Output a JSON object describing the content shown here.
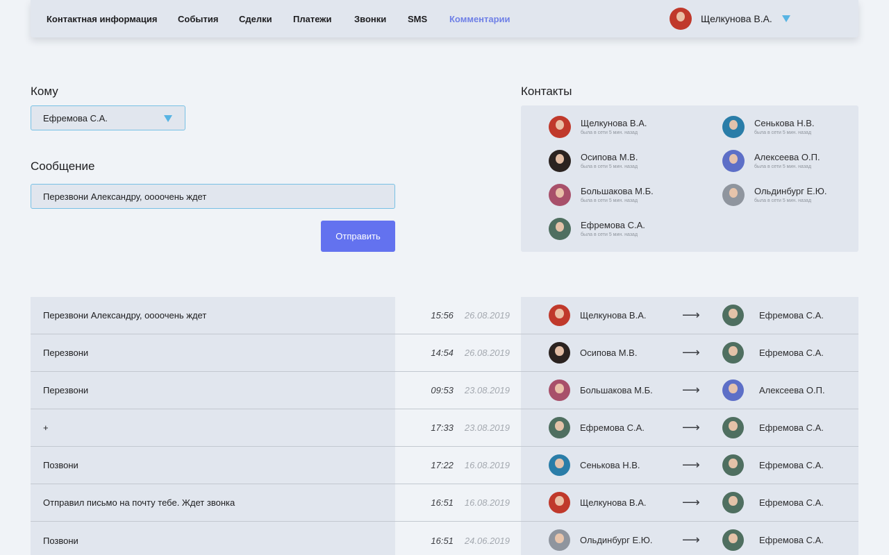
{
  "nav": {
    "items": [
      "Контактная информация",
      "События",
      "Сделки",
      "Платежи",
      "Звонки",
      "SMS",
      "Комментарии"
    ],
    "active": "Комментарии",
    "user": "Щелкунова В.А."
  },
  "form": {
    "to_label": "Кому",
    "to_value": "Ефремова С.А.",
    "message_label": "Сообщение",
    "message_value": "Перезвони Александру, оооочень ждет",
    "send_label": "Отправить"
  },
  "contacts": {
    "title": "Контакты",
    "status_text": "была в сети 5 мин. назад",
    "items": [
      {
        "name": "Щелкунова В.А.",
        "status": "была в сети 5 мин. назад"
      },
      {
        "name": "Сенькова Н.В.",
        "status": "была в сети 5 мин. назад"
      },
      {
        "name": "Осипова М.В.",
        "status": "была в сети 5 мин. назад"
      },
      {
        "name": "Алексеева О.П.",
        "status": "была в сети 5 мин. назад"
      },
      {
        "name": "Большакова М.Б.",
        "status": "была в сети 5 мин. назад"
      },
      {
        "name": "Ольдинбург Е.Ю.",
        "status": "была в сети 5 мин. назад"
      },
      {
        "name": "Ефремова С.А.",
        "status": "была в сети 5 мин. назад"
      }
    ]
  },
  "comments": [
    {
      "text": "Перезвони Александру, оооочень ждет",
      "time": "15:56",
      "date": "26.08.2019",
      "from": "Щелкунова В.А.",
      "to": "Ефремова С.А."
    },
    {
      "text": "Перезвони",
      "time": "14:54",
      "date": "26.08.2019",
      "from": "Осипова М.В.",
      "to": "Ефремова С.А."
    },
    {
      "text": "Перезвони",
      "time": "09:53",
      "date": "23.08.2019",
      "from": "Большакова М.Б.",
      "to": "Алексеева О.П."
    },
    {
      "text": "+",
      "time": "17:33",
      "date": "23.08.2019",
      "from": "Ефремова С.А.",
      "to": "Ефремова С.А."
    },
    {
      "text": "Позвони",
      "time": "17:22",
      "date": "16.08.2019",
      "from": "Сенькова Н.В.",
      "to": "Ефремова С.А."
    },
    {
      "text": "Отправил письмо на почту тебе. Ждет звонка",
      "time": "16:51",
      "date": "16.08.2019",
      "from": "Щелкунова В.А.",
      "to": "Ефремова С.А."
    },
    {
      "text": "Позвони",
      "time": "16:51",
      "date": "24.06.2019",
      "from": "Ольдинбург Е.Ю.",
      "to": "Ефремова С.А."
    }
  ],
  "arrow_glyph": "⟶",
  "colors": {
    "accent": "#6372ef",
    "active_nav": "#6f80e6",
    "input_border": "#77c0e4",
    "caret": "#58b4e3",
    "panel_bg": "#e1e6ee",
    "page_bg": "#f0f3f7"
  },
  "avatar_colors": {
    "Щелкунова В.А.": "#c0392b",
    "Сенькова Н.В.": "#2a7da8",
    "Осипова М.В.": "#2b2320",
    "Алексеева О.П.": "#5d6fc7",
    "Большакова М.Б.": "#a8506a",
    "Ольдинбург Е.Ю.": "#8f959e",
    "Ефремова С.А.": "#4f6f60"
  }
}
